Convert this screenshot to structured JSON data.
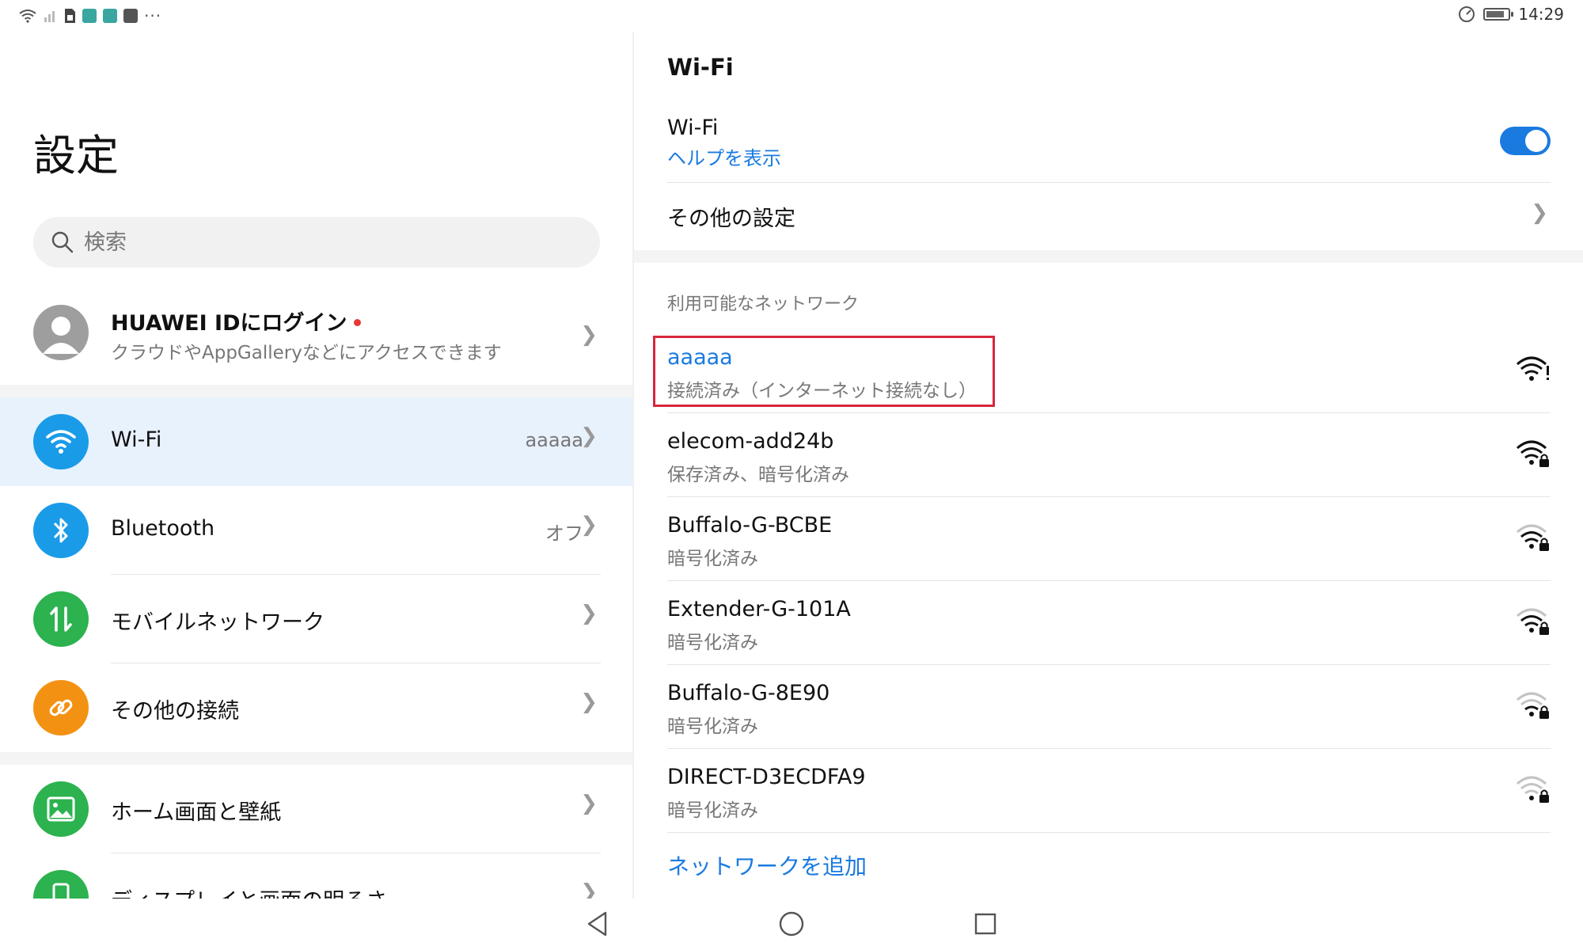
{
  "status_bar": {
    "time": "14:29"
  },
  "left_pane": {
    "title": "設定",
    "search_placeholder": "検索",
    "account": {
      "title": "HUAWEI IDにログイン",
      "subtitle": "クラウドやAppGalleryなどにアクセスできます"
    },
    "items": [
      {
        "label": "Wi-Fi",
        "value": "aaaaa",
        "icon": "wifi-icon",
        "color": "#1a9be8"
      },
      {
        "label": "Bluetooth",
        "value": "オフ",
        "icon": "bluetooth-icon",
        "color": "#1a9be8"
      },
      {
        "label": "モバイルネットワーク",
        "value": "",
        "icon": "mobile-data-icon",
        "color": "#2cb24f"
      },
      {
        "label": "その他の接続",
        "value": "",
        "icon": "link-icon",
        "color": "#f39212"
      },
      {
        "label": "ホーム画面と壁紙",
        "value": "",
        "icon": "image-icon",
        "color": "#2cb24f"
      },
      {
        "label": "ディスプレイと画面の明るさ",
        "value": "",
        "icon": "display-icon",
        "color": "#2cb24f"
      }
    ]
  },
  "right_pane": {
    "header": "Wi-Fi",
    "wifi_label": "Wi-Fi",
    "wifi_enabled": true,
    "help_link": "ヘルプを表示",
    "more_settings": "その他の設定",
    "section_title": "利用可能なネットワーク",
    "networks": [
      {
        "ssid": "aaaaa",
        "status": "接続済み（インターネット接続なし）",
        "connected": true,
        "locked": false,
        "strength": "strong-warning"
      },
      {
        "ssid": "elecom-add24b",
        "status": "保存済み、暗号化済み",
        "connected": false,
        "locked": true,
        "strength": "strong"
      },
      {
        "ssid": "Buffalo-G-BCBE",
        "status": "暗号化済み",
        "connected": false,
        "locked": true,
        "strength": "medium"
      },
      {
        "ssid": "Extender-G-101A",
        "status": "暗号化済み",
        "connected": false,
        "locked": true,
        "strength": "medium"
      },
      {
        "ssid": "Buffalo-G-8E90",
        "status": "暗号化済み",
        "connected": false,
        "locked": true,
        "strength": "weak"
      },
      {
        "ssid": "DIRECT-D3ECDFA9",
        "status": "暗号化済み",
        "connected": false,
        "locked": true,
        "strength": "weak"
      }
    ],
    "add_network": "ネットワークを追加"
  },
  "colors": {
    "accent": "#1a7ae0",
    "highlight": "#d7263d"
  }
}
